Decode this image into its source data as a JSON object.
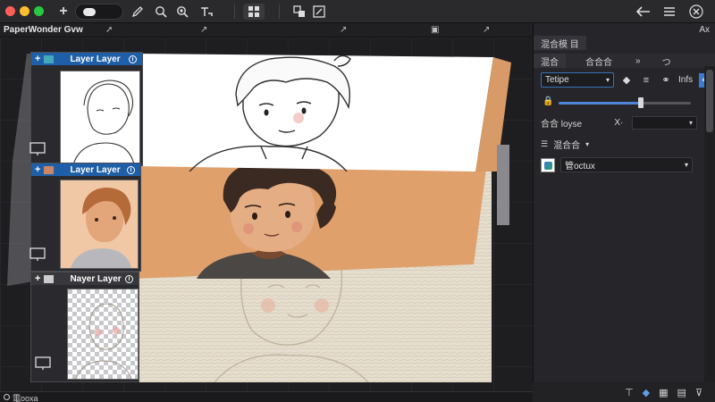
{
  "app": {
    "document_title": "PaperWonder Gvw"
  },
  "toolbar": {
    "icons": [
      "plus-icon",
      "toggle-icon",
      "pen-icon",
      "search-icon",
      "zoom-icon",
      "text-tool-icon",
      "grid-icon",
      "layers-icon",
      "edit-icon",
      "back-icon",
      "menu-icon",
      "close-icon"
    ]
  },
  "doc_tools": {
    "icons": [
      "pin-icon",
      "arrow-icon",
      "arrow-icon",
      "frame-icon",
      "arrow-icon"
    ]
  },
  "layers": [
    {
      "name": "Layer Layer",
      "active": true
    },
    {
      "name": "Layer Layer",
      "active": true
    },
    {
      "name": "Nayer Layer",
      "active": false
    }
  ],
  "panel": {
    "header_tab": "混合模 目",
    "header_right": "Ax",
    "tabs": [
      "混合",
      "合合合",
      "»",
      "つ"
    ],
    "blend_mode": "Tetipe",
    "blend_icons_text": "Infs",
    "opacity_fraction": 0.62,
    "property_label": "合合 loyse",
    "group_label": "混合合",
    "layer_select_value": "管octux"
  },
  "status": {
    "text": "電ooxa"
  },
  "colors": {
    "accent": "#3d7bd0",
    "layer_header": "#1f5fa8",
    "skin": "#e2a070",
    "paper": "#e9e2d2"
  }
}
